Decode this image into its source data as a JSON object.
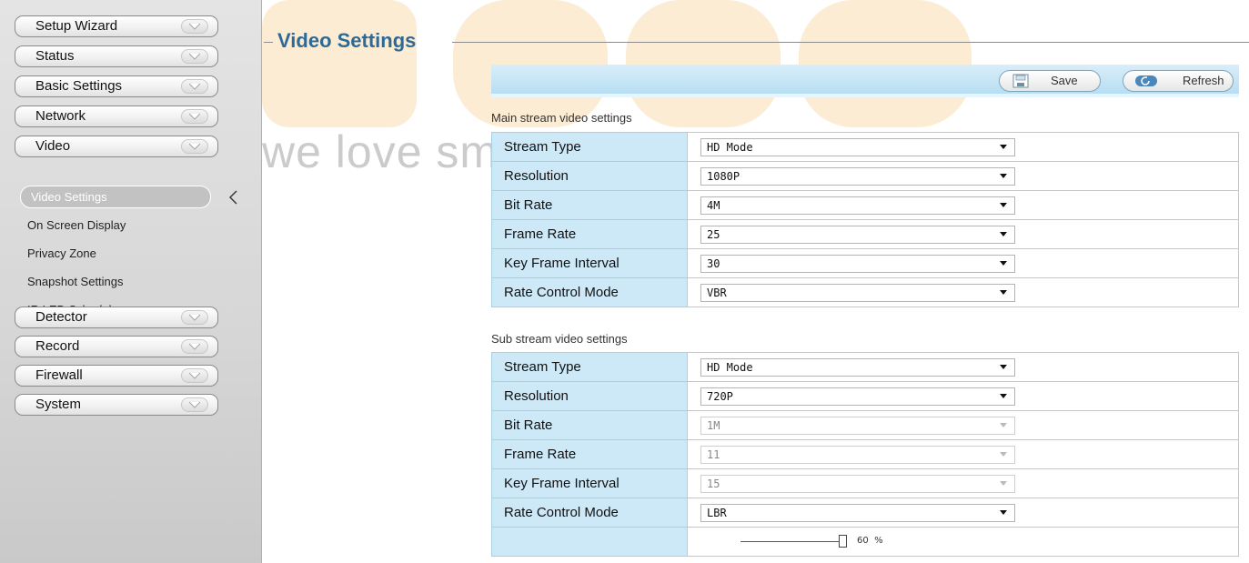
{
  "sidebar": {
    "menu": [
      {
        "label": "Setup Wizard"
      },
      {
        "label": "Status"
      },
      {
        "label": "Basic Settings"
      },
      {
        "label": "Network"
      },
      {
        "label": "Video"
      },
      {
        "label": "Detector"
      },
      {
        "label": "Record"
      },
      {
        "label": "Firewall"
      },
      {
        "label": "System"
      }
    ],
    "video_submenu": {
      "active": "Video Settings",
      "items": [
        "On Screen Display",
        "Privacy Zone",
        "Snapshot Settings",
        "IR LED Schedule"
      ]
    }
  },
  "watermark": {
    "text": "we love smart",
    "color": "#f5c98a"
  },
  "page": {
    "title": "Video Settings"
  },
  "toolbar": {
    "save_label": "Save",
    "refresh_label": "Refresh"
  },
  "main_stream": {
    "section_label": "Main stream video settings",
    "rows": [
      {
        "label": "Stream Type",
        "value": "HD Mode"
      },
      {
        "label": "Resolution",
        "value": "1080P"
      },
      {
        "label": "Bit Rate",
        "value": "4M"
      },
      {
        "label": "Frame Rate",
        "value": "25"
      },
      {
        "label": "Key Frame Interval",
        "value": "30"
      },
      {
        "label": "Rate Control Mode",
        "value": "VBR"
      }
    ]
  },
  "sub_stream": {
    "section_label": "Sub stream video settings",
    "rows": [
      {
        "label": "Stream Type",
        "value": "HD Mode",
        "disabled": false
      },
      {
        "label": "Resolution",
        "value": "720P",
        "disabled": false
      },
      {
        "label": "Bit Rate",
        "value": "1M",
        "disabled": true
      },
      {
        "label": "Frame Rate",
        "value": "11",
        "disabled": true
      },
      {
        "label": "Key Frame Interval",
        "value": "15",
        "disabled": true
      },
      {
        "label": "Rate Control Mode",
        "value": "LBR",
        "disabled": false
      }
    ],
    "quality_slider": {
      "value": "60",
      "unit": "%"
    }
  },
  "colors": {
    "accent_title": "#2e6a96",
    "label_cell_bg": "#cde8f7",
    "toolbar_bg": "#b7def3"
  }
}
